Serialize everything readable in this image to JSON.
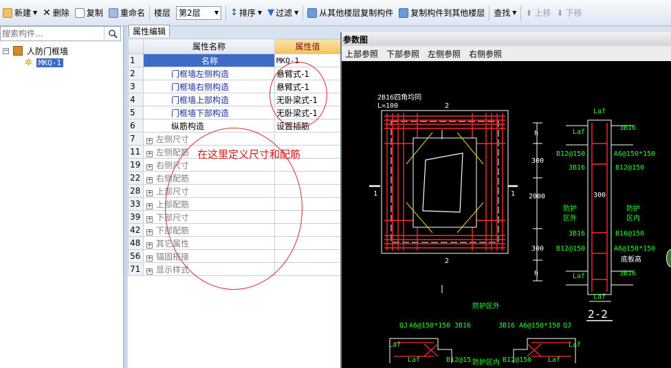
{
  "toolbar": {
    "new": "新建",
    "delete": "删除",
    "copy": "复制",
    "rename": "重命名",
    "floor_label": "楼层",
    "floor_value": "第2层",
    "sort": "排序",
    "filter": "过滤",
    "copy_from_other": "从其他楼层复制构件",
    "copy_to_other": "复制构件到其他楼层",
    "find": "查找",
    "move_up": "上移",
    "move_down": "下移"
  },
  "left_panel": {
    "search_placeholder": "搜索构件...",
    "tree_root": "人防门框墙",
    "tree_child": "MKQ-1"
  },
  "tab": {
    "label": "属性编辑"
  },
  "grid": {
    "col_name": "属性名称",
    "col_value": "属性值",
    "rows": [
      {
        "num": "1",
        "name": "名称",
        "value": "MKQ-1",
        "expand": false,
        "style": "selected"
      },
      {
        "num": "2",
        "name": "门框墙左侧构造",
        "value": "悬臂式-1",
        "expand": false,
        "style": "blue"
      },
      {
        "num": "3",
        "name": "门框墙右侧构造",
        "value": "悬臂式-1",
        "expand": false,
        "style": "blue"
      },
      {
        "num": "4",
        "name": "门框墙上部构造",
        "value": "无卧梁式-1",
        "expand": false,
        "style": "blue"
      },
      {
        "num": "5",
        "name": "门框墙下部构造",
        "value": "无卧梁式-1",
        "expand": false,
        "style": "blue"
      },
      {
        "num": "6",
        "name": "纵筋构造",
        "value": "设置插筋",
        "expand": false,
        "style": "normal"
      },
      {
        "num": "7",
        "name": "左侧尺寸",
        "value": "",
        "expand": true,
        "style": "gray"
      },
      {
        "num": "11",
        "name": "左侧配筋",
        "value": "",
        "expand": true,
        "style": "gray"
      },
      {
        "num": "19",
        "name": "右侧尺寸",
        "value": "",
        "expand": true,
        "style": "gray"
      },
      {
        "num": "22",
        "name": "右侧配筋",
        "value": "",
        "expand": true,
        "style": "gray"
      },
      {
        "num": "28",
        "name": "上部尺寸",
        "value": "",
        "expand": true,
        "style": "gray"
      },
      {
        "num": "33",
        "name": "上部配筋",
        "value": "",
        "expand": true,
        "style": "gray"
      },
      {
        "num": "39",
        "name": "下部尺寸",
        "value": "",
        "expand": true,
        "style": "gray"
      },
      {
        "num": "42",
        "name": "下部配筋",
        "value": "",
        "expand": true,
        "style": "gray"
      },
      {
        "num": "48",
        "name": "其它属性",
        "value": "",
        "expand": true,
        "style": "gray"
      },
      {
        "num": "56",
        "name": "锚固搭接",
        "value": "",
        "expand": true,
        "style": "gray"
      },
      {
        "num": "71",
        "name": "显示样式",
        "value": "",
        "expand": true,
        "style": "gray"
      }
    ],
    "annotation": "在这里定义尺寸和配筋"
  },
  "ref_window": {
    "title": "参数图",
    "menu": [
      "上部参照",
      "下部参照",
      "左侧参照",
      "右侧参照"
    ],
    "drawing": {
      "left_labels": {
        "rebar": "2B16四角均同",
        "len": "L=100",
        "sec_top": "2",
        "sec_bottom": "2",
        "side_left": "1",
        "side_right": "1"
      },
      "dims": {
        "h_top": "h",
        "d300_top": "300",
        "d2000": "2000",
        "d300_bottom": "300",
        "h_bottom": "h"
      },
      "section_labels": {
        "laf_top": "Laf",
        "laf_left": "Laf",
        "top_3b16": "3B16",
        "b12_150_a": "B12@150",
        "a6_top": "A6@150*150",
        "mid_3b16_a": "3B16",
        "b12_150_b": "B12@150",
        "d300_mid": "300",
        "outside": "防护\n区外",
        "inside": "防护\n区内",
        "mid_3b16_b": "3B16",
        "b16_150": "B16@150",
        "b12_150_c": "B12@150",
        "a6_bottom": "A6@150*150",
        "bottom_plate": "底板高",
        "laf_bl": "Laf",
        "bot_3b16": "3B16",
        "laf_bottom": "Laf",
        "section_title": "2-2"
      },
      "bottom_labels": {
        "outside_top": "防护区外",
        "qj_left": "QJ",
        "a6_l": "A6@150*150",
        "b3_l": "3B16",
        "b3_r": "3B16",
        "a6_r": "A6@150*150",
        "qj_right": "QJ",
        "laf_l": "Laf",
        "laf_l2": "Laf",
        "b12_l": "B12@15",
        "inside_bottom": "防护区内",
        "b12_r": "B12@150",
        "laf_r": "Laf",
        "laf_r2": "Laf"
      }
    }
  },
  "colors": {
    "cad_bg": "#000000",
    "rebar": "#ff2a2a",
    "dim": "#ffffff",
    "label_green": "#21ff21",
    "annotation": "#e01414"
  }
}
